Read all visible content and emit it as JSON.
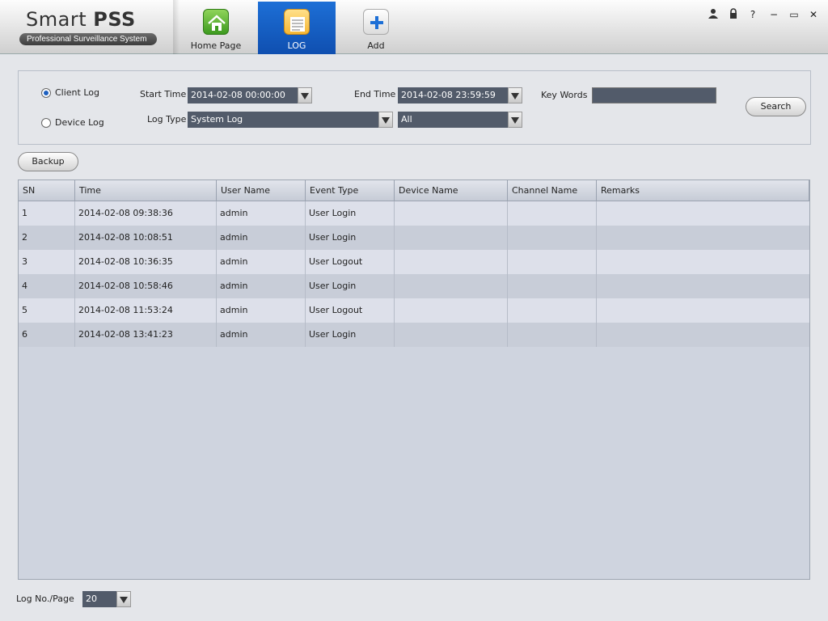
{
  "app": {
    "title_part1": "Smart",
    "title_part2": "PSS",
    "subtitle": "Professional Surveillance System"
  },
  "tabs": [
    {
      "label": "Home Page",
      "icon": "home-icon"
    },
    {
      "label": "LOG",
      "icon": "log-icon",
      "active": true
    },
    {
      "label": "Add",
      "icon": "add-icon"
    }
  ],
  "window_controls": {
    "user": "user-icon",
    "lock": "lock-icon",
    "help": "?",
    "minimize": "−",
    "maximize": "▭",
    "close": "✕"
  },
  "filter": {
    "client_log_label": "Client Log",
    "device_log_label": "Device Log",
    "selected": "Client Log",
    "start_time_label": "Start Time",
    "start_time_value": "2014-02-08 00:00:00",
    "end_time_label": "End Time",
    "end_time_value": "2014-02-08 23:59:59",
    "key_words_label": "Key Words",
    "key_words_value": "",
    "log_type_label": "Log Type",
    "log_type_value": "System Log",
    "log_subtype_value": "All",
    "search_label": "Search"
  },
  "backup_label": "Backup",
  "table": {
    "columns": [
      "SN",
      "Time",
      "User Name",
      "Event Type",
      "Device Name",
      "Channel Name",
      "Remarks"
    ],
    "rows": [
      [
        "1",
        "2014-02-08 09:38:36",
        "admin",
        "User Login",
        "",
        "",
        ""
      ],
      [
        "2",
        "2014-02-08 10:08:51",
        "admin",
        "User Login",
        "",
        "",
        ""
      ],
      [
        "3",
        "2014-02-08 10:36:35",
        "admin",
        "User Logout",
        "",
        "",
        ""
      ],
      [
        "4",
        "2014-02-08 10:58:46",
        "admin",
        "User Login",
        "",
        "",
        ""
      ],
      [
        "5",
        "2014-02-08 11:53:24",
        "admin",
        "User Logout",
        "",
        "",
        ""
      ],
      [
        "6",
        "2014-02-08 13:41:23",
        "admin",
        "User Login",
        "",
        "",
        ""
      ]
    ]
  },
  "footer": {
    "per_page_label": "Log No./Page",
    "per_page_value": "20"
  },
  "colors": {
    "active_tab": "#1d6fd6",
    "field_bg": "#525b6a",
    "row_odd": "#dde0ea",
    "row_even": "#c8cdd8"
  }
}
